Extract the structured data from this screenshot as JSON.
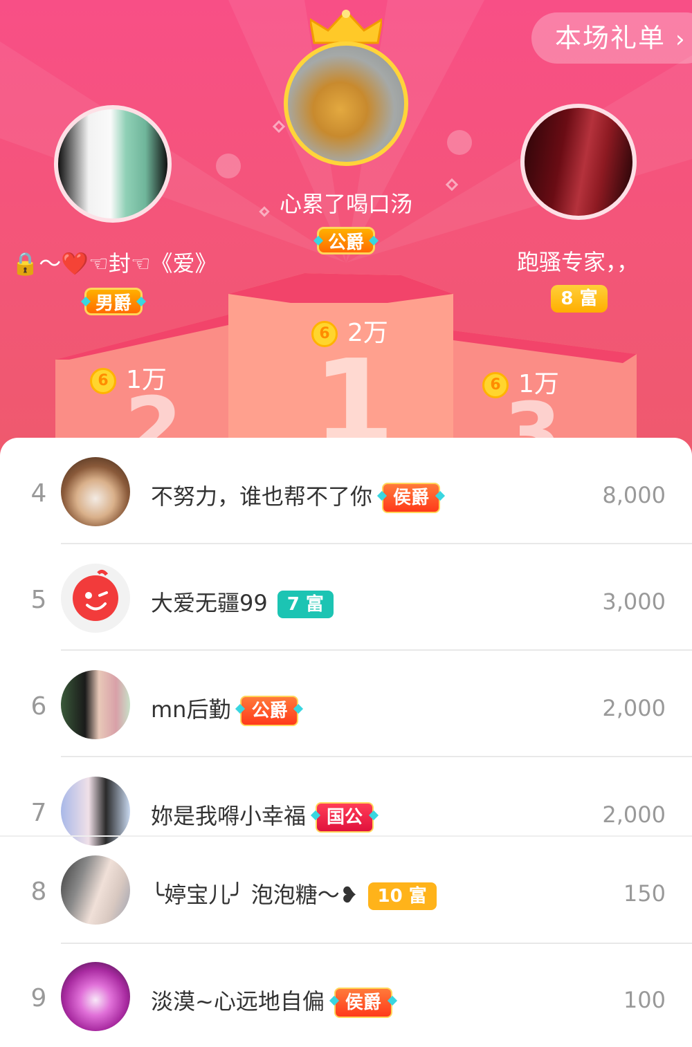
{
  "header": {
    "gift_list_label": "本场礼单",
    "gift_list_chevron": "›"
  },
  "podium": {
    "first": {
      "name": "心累了喝口汤",
      "medal": "公爵",
      "score": "2万",
      "rank_label": "1"
    },
    "second": {
      "name": "🔒～❤️☜封☜《爱》",
      "medal": "男爵",
      "score": "1万",
      "rank_label": "2"
    },
    "third": {
      "name": "跑骚专家，，",
      "medal": "8 富",
      "score": "1万",
      "rank_label": "3"
    },
    "coin_glyph": "6"
  },
  "list": [
    {
      "rank": "4",
      "name": "不努力，谁也帮不了你",
      "badge": "侯爵",
      "badge_style": "noble",
      "score": "8,000"
    },
    {
      "rank": "5",
      "name": "大爱无疆99",
      "badge": "7 富",
      "badge_style": "teal",
      "score": "3,000"
    },
    {
      "rank": "6",
      "name": "mn后勤",
      "badge": "公爵",
      "badge_style": "noble",
      "score": "2,000"
    },
    {
      "rank": "7",
      "name": "妳是我嘚小幸福",
      "badge": "国公",
      "badge_style": "red",
      "score": "2,000"
    },
    {
      "rank": "8",
      "name": "╰婷宝儿╯ 泡泡糖～❥",
      "badge": "10 富",
      "badge_style": "gold",
      "score": "150"
    },
    {
      "rank": "9",
      "name": "淡漠~心远地自偏",
      "badge": "侯爵",
      "badge_style": "noble",
      "score": "100"
    }
  ],
  "colors": {
    "background_top": "#f84f86",
    "coin": "#ffd52e",
    "rank_text": "#999999",
    "name_text": "#333333"
  }
}
